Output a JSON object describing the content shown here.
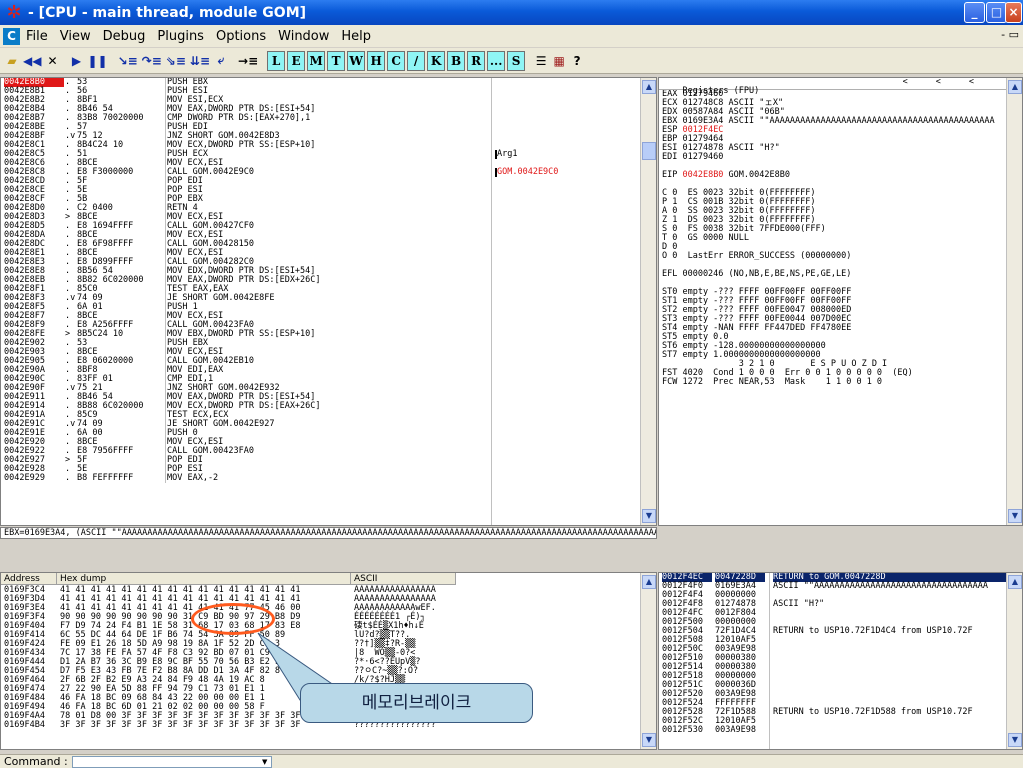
{
  "window": {
    "title": " - [CPU - main thread, module GOM]",
    "controls": [
      "_",
      "□",
      "×"
    ]
  },
  "menu": {
    "items": [
      "File",
      "View",
      "Debug",
      "Plugins",
      "Options",
      "Window",
      "Help"
    ],
    "right_controls": "- ▭"
  },
  "toolbar": {
    "icons": [
      "open-icon",
      "restart-icon",
      "close-icon",
      "run-icon",
      "pause-icon",
      "step-into-icon",
      "step-over-icon",
      "trace-into-icon",
      "trace-over-icon",
      "execute-till-return-icon",
      "goto-icon"
    ],
    "letters": [
      "L",
      "E",
      "M",
      "T",
      "W",
      "H",
      "C",
      "/",
      "K",
      "B",
      "R",
      "...",
      "S"
    ],
    "extra": [
      "list-icon",
      "grid-icon",
      "?"
    ]
  },
  "disasm": {
    "rows": [
      [
        "0042E8B0",
        ".",
        "53",
        "PUSH EBX",
        ""
      ],
      [
        "0042E8B1",
        ".",
        "56",
        "PUSH ESI",
        ""
      ],
      [
        "0042E8B2",
        ".",
        "8BF1",
        "MOV ESI,ECX",
        ""
      ],
      [
        "0042E8B4",
        ".",
        "8B46 54",
        "MOV EAX,DWORD PTR DS:[ESI+54]",
        ""
      ],
      [
        "0042E8B7",
        ".",
        "83B8 70020000",
        "CMP DWORD PTR DS:[EAX+270],1",
        ""
      ],
      [
        "0042E8BE",
        ".",
        "57",
        "PUSH EDI",
        ""
      ],
      [
        "0042E8BF",
        ".v",
        "75 12",
        "JNZ SHORT GOM.0042E8D3",
        ""
      ],
      [
        "0042E8C1",
        ".",
        "8B4C24 10",
        "MOV ECX,DWORD PTR SS:[ESP+10]",
        ""
      ],
      [
        "0042E8C5",
        ".",
        "51",
        "PUSH ECX",
        "Arg1"
      ],
      [
        "0042E8C6",
        ".",
        "8BCE",
        "MOV ECX,ESI",
        ""
      ],
      [
        "0042E8C8",
        ".",
        "E8 F3000000",
        "CALL GOM.0042E9C0",
        "GOM.0042E9C0"
      ],
      [
        "0042E8CD",
        ".",
        "5F",
        "POP EDI",
        ""
      ],
      [
        "0042E8CE",
        ".",
        "5E",
        "POP ESI",
        ""
      ],
      [
        "0042E8CF",
        ".",
        "5B",
        "POP EBX",
        ""
      ],
      [
        "0042E8D0",
        ".",
        "C2 0400",
        "RETN 4",
        ""
      ],
      [
        "0042E8D3",
        ">",
        "8BCE",
        "MOV ECX,ESI",
        ""
      ],
      [
        "0042E8D5",
        ".",
        "E8 1694FFFF",
        "CALL GOM.00427CF0",
        ""
      ],
      [
        "0042E8DA",
        ".",
        "8BCE",
        "MOV ECX,ESI",
        ""
      ],
      [
        "0042E8DC",
        ".",
        "E8 6F98FFFF",
        "CALL GOM.00428150",
        ""
      ],
      [
        "0042E8E1",
        ".",
        "8BCE",
        "MOV ECX,ESI",
        ""
      ],
      [
        "0042E8E3",
        ".",
        "E8 D899FFFF",
        "CALL GOM.004282C0",
        ""
      ],
      [
        "0042E8E8",
        ".",
        "8B56 54",
        "MOV EDX,DWORD PTR DS:[ESI+54]",
        ""
      ],
      [
        "0042E8EB",
        ".",
        "8B82 6C020000",
        "MOV EAX,DWORD PTR DS:[EDX+26C]",
        ""
      ],
      [
        "0042E8F1",
        ".",
        "85C0",
        "TEST EAX,EAX",
        ""
      ],
      [
        "0042E8F3",
        ".v",
        "74 09",
        "JE SHORT GOM.0042E8FE",
        ""
      ],
      [
        "0042E8F5",
        ".",
        "6A 01",
        "PUSH 1",
        ""
      ],
      [
        "0042E8F7",
        ".",
        "8BCE",
        "MOV ECX,ESI",
        ""
      ],
      [
        "0042E8F9",
        ".",
        "E8 A256FFFF",
        "CALL GOM.00423FA0",
        ""
      ],
      [
        "0042E8FE",
        ">",
        "8B5C24 10",
        "MOV EBX,DWORD PTR SS:[ESP+10]",
        ""
      ],
      [
        "0042E902",
        ".",
        "53",
        "PUSH EBX",
        ""
      ],
      [
        "0042E903",
        ".",
        "8BCE",
        "MOV ECX,ESI",
        ""
      ],
      [
        "0042E905",
        ".",
        "E8 06020000",
        "CALL GOM.0042EB10",
        ""
      ],
      [
        "0042E90A",
        ".",
        "8BF8",
        "MOV EDI,EAX",
        ""
      ],
      [
        "0042E90C",
        ".",
        "83FF 01",
        "CMP EDI,1",
        ""
      ],
      [
        "0042E90F",
        ".v",
        "75 21",
        "JNZ SHORT GOM.0042E932",
        ""
      ],
      [
        "0042E911",
        ".",
        "8B46 54",
        "MOV EAX,DWORD PTR DS:[ESI+54]",
        ""
      ],
      [
        "0042E914",
        ".",
        "8B88 6C020000",
        "MOV ECX,DWORD PTR DS:[EAX+26C]",
        ""
      ],
      [
        "0042E91A",
        ".",
        "85C9",
        "TEST ECX,ECX",
        ""
      ],
      [
        "0042E91C",
        ".v",
        "74 09",
        "JE SHORT GOM.0042E927",
        ""
      ],
      [
        "0042E91E",
        ".",
        "6A 00",
        "PUSH 0",
        ""
      ],
      [
        "0042E920",
        ".",
        "8BCE",
        "MOV ECX,ESI",
        ""
      ],
      [
        "0042E922",
        ".",
        "E8 7956FFFF",
        "CALL GOM.00423FA0",
        ""
      ],
      [
        "0042E927",
        ">",
        "5F",
        "POP EDI",
        ""
      ],
      [
        "0042E928",
        ".",
        "5E",
        "POP ESI",
        ""
      ],
      [
        "0042E929",
        ".",
        "B8 FEFFFFFF",
        "MOV EAX,-2",
        ""
      ]
    ]
  },
  "infoline": "EBX=0169E3A4, (ASCII \"\"AAAAAAAAAAAAAAAAAAAAAAAAAAAAAAAAAAAAAAAAAAAAAAAAAAAAAAAAAAAAAAAAAAAAAAAAAAAAAAAAAAAAAAAAAAAAAAAAAAAAAAAAAAAAAAAAAAAAAAAAAAAAAAAAAAAAAAAAAAAAAAAAAAAAAA",
  "registers": {
    "header": "Registers (FPU)",
    "header_arrows": [
      "<",
      "<",
      "<"
    ],
    "lines": [
      "EAX 01279460",
      "ECX 012748C8 ASCII \"ェX\"",
      "EDX 00587A84 ASCII \"06B\"",
      "EBX 0169E3A4 ASCII \"\"AAAAAAAAAAAAAAAAAAAAAAAAAAAAAAAAAAAAAAAAAAAA",
      "ESP 0012F4EC",
      "EBP 01279464",
      "ESI 01274878 ASCII \"H?\"",
      "EDI 01279460",
      "",
      "EIP 0042E8B0 GOM.0042E8B0",
      "",
      "C 0  ES 0023 32bit 0(FFFFFFFF)",
      "P 1  CS 001B 32bit 0(FFFFFFFF)",
      "A 0  SS 0023 32bit 0(FFFFFFFF)",
      "Z 1  DS 0023 32bit 0(FFFFFFFF)",
      "S 0  FS 0038 32bit 7FFDE000(FFF)",
      "T 0  GS 0000 NULL",
      "D 0",
      "O 0  LastErr ERROR_SUCCESS (00000000)",
      "",
      "EFL 00000246 (NO,NB,E,BE,NS,PE,GE,LE)",
      "",
      "ST0 empty -??? FFFF 00FF00FF 00FF00FF",
      "ST1 empty -??? FFFF 00FF00FF 00FF00FF",
      "ST2 empty -??? FFFF 00FE0047 008000ED",
      "ST3 empty -??? FFFF 00FE0044 007D00EC",
      "ST4 empty -NAN FFFF FF447DED FF4780EE",
      "ST5 empty 0.0",
      "ST6 empty -128.00000000000000000",
      "ST7 empty 1.0000000000000000000",
      "               3 2 1 0       E S P U O Z D I",
      "FST 4020  Cond 1 0 0 0  Err 0 0 1 0 0 0 0 0  (EQ)",
      "FCW 1272  Prec NEAR,53  Mask    1 1 0 0 1 0"
    ]
  },
  "dump": {
    "headers": [
      "Address",
      "Hex dump",
      "ASCII"
    ],
    "rows": [
      [
        "0169F3C4",
        "41 41 41 41 41 41 41 41 41 41 41 41 41 41 41 41",
        "AAAAAAAAAAAAAAAA"
      ],
      [
        "0169F3D4",
        "41 41 41 41 41 41 41 41 41 41 41 41 41 41 41 41",
        "AAAAAAAAAAAAAAAA"
      ],
      [
        "0169F3E4",
        "41 41 41 41 41 41 41 41 41 41 41 41 77 45 46 00",
        "AAAAAAAAAAAAwEF."
      ],
      [
        "0169F3F4",
        "90 90 90 90 90 90 90 90 31 C9 BD 90 97 29 B8 D9",
        "ÉÉÉÉÉÉÉÉ1 ┌É)┐"
      ],
      [
        "0169F404",
        "F7 D9 74 24 F4 B1 1E 58 31 68 17 03 68 17 83 E8",
        "䃀t$ÉÉ▒X1h♦h↓É"
      ],
      [
        "0169F414",
        "6C 55 DC 44 64 DE 1F B6 74 54 5A 89 FF 50 89",
        "lU?d?▒▒T??."
      ],
      [
        "0169F424",
        "FE 09 E1 26 18 5D A9 98 19 8A 1F 52 2D C7 3",
        "??†]▒▒‡?R-▒▒"
      ],
      [
        "0169F434",
        "7C 17 38 FE FA 57 4F F8 C3 92 BD 07 01 C9 3",
        "|8  WO▒▒-0?<"
      ],
      [
        "0169F444",
        "D1 2A B7 36 3C B9 E8 9C BF 55 70 56 B3 E2 F",
        "?*·6<??ÉUpV▒?"
      ],
      [
        "0169F454",
        "D7 F5 E3 43 FB 7E F2 B8 8A DD D1 3A 4F 82 8",
        "??ㅇC?~▒▒?:O?"
      ],
      [
        "0169F464",
        "2F 6B 2F B2 E9 A3 24 84 F9 48 4A 19 AC 8",
        "/k/?$?HJ▒▒"
      ],
      [
        "0169F474",
        "27 22 90 EA 5D 88 FF 94 79 C1 73 01 E1 1",
        "'\"?]??ys???"
      ],
      [
        "0169F484",
        "46 FA 18 BC 09 68 84 43 22 00 00 00 E1 1",
        "F?▒h?C\"...??"
      ],
      [
        "0169F494",
        "46 FA 18 BC 6D 01 21 02 02 00 00 00 58 F",
        "F?▒m!▒...X?"
      ],
      [
        "0169F4A4",
        "78 01 D8 00 3F 3F 3F 3F 3F 3F 3F 3F 3F 3F 3F 3F",
        "x0??????????????"
      ],
      [
        "0169F4B4",
        "3F 3F 3F 3F 3F 3F 3F 3F 3F 3F 3F 3F 3F 3F 3F 3F",
        "????????????????"
      ]
    ]
  },
  "stack": {
    "rows": [
      [
        "0012F4EC",
        "0047228D",
        "RETURN to GOM.0047228D"
      ],
      [
        "0012F4F0",
        "0169E3A4",
        "ASCII \"\"AAAAAAAAAAAAAAAAAAAAAAAAAAAAAAAAAA"
      ],
      [
        "0012F4F4",
        "00000000",
        ""
      ],
      [
        "0012F4F8",
        "01274878",
        "ASCII \"H?\""
      ],
      [
        "0012F4FC",
        "0012F804",
        ""
      ],
      [
        "0012F500",
        "00000000",
        ""
      ],
      [
        "0012F504",
        "72F1D4C4",
        "RETURN to USP10.72F1D4C4 from USP10.72F"
      ],
      [
        "0012F508",
        "12010AF5",
        ""
      ],
      [
        "0012F50C",
        "003A9E98",
        ""
      ],
      [
        "0012F510",
        "00000380",
        ""
      ],
      [
        "0012F514",
        "00000380",
        ""
      ],
      [
        "0012F518",
        "00000000",
        ""
      ],
      [
        "0012F51C",
        "0000036D",
        ""
      ],
      [
        "0012F520",
        "003A9E98",
        ""
      ],
      [
        "0012F524",
        "FFFFFFFF",
        ""
      ],
      [
        "0012F528",
        "72F1D588",
        "RETURN to USP10.72F1D588 from USP10.72F"
      ],
      [
        "0012F52C",
        "12010AF5",
        ""
      ],
      [
        "0012F530",
        "003A9E98",
        ""
      ]
    ]
  },
  "command": {
    "label": "Command :"
  },
  "annotation": {
    "text": "메모리브레이크"
  },
  "colors": {
    "accent_red": "#e01818",
    "title_blue": "#0a5ad8",
    "annotation_orange": "#ff5a1e",
    "annotation_box": "#b8d8e8"
  }
}
